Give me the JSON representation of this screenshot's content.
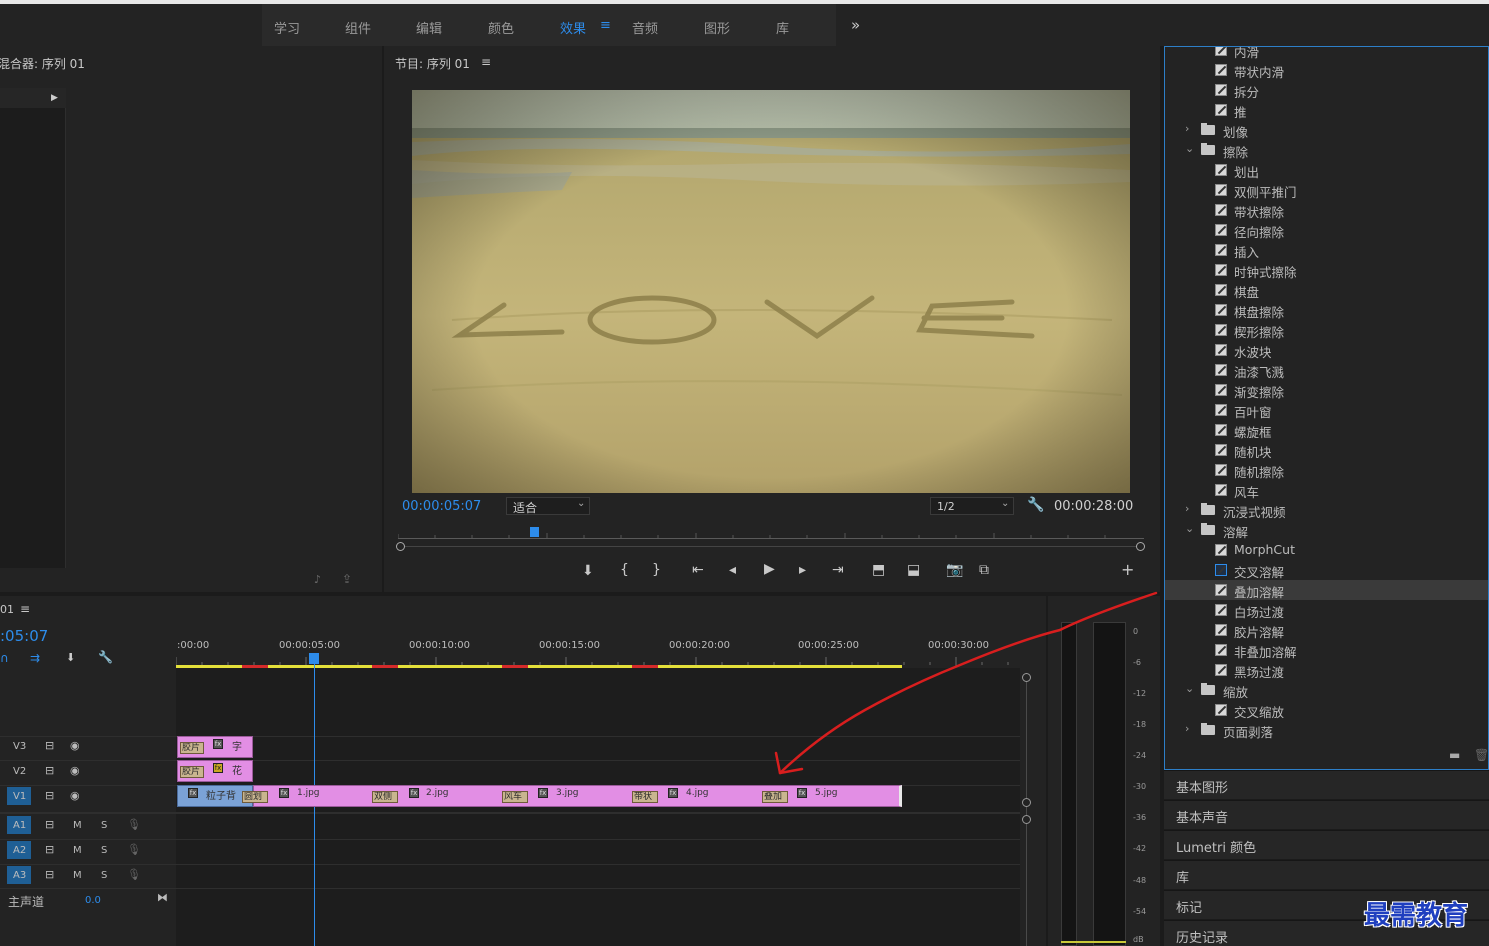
{
  "workspace_tabs": [
    "学习",
    "组件",
    "编辑",
    "颜色",
    "效果",
    "音频",
    "图形",
    "库"
  ],
  "workspace_active": "效果",
  "workspace_menu_icon": "≡",
  "workspace_more": "»",
  "source_panel": {
    "title": "混合器: 序列 01",
    "play_glyph": "▶"
  },
  "program_monitor": {
    "title": "节目: 序列 01",
    "menu_glyph": "≡",
    "current_time": "00:00:05:07",
    "fit_label": "适合",
    "resolution": "1/2",
    "duration": "00:00:28:00",
    "image_text": "LOVE"
  },
  "effects_list": [
    {
      "kind": "item",
      "label": "内滑"
    },
    {
      "kind": "item",
      "label": "带状内滑"
    },
    {
      "kind": "item",
      "label": "拆分"
    },
    {
      "kind": "item",
      "label": "推"
    },
    {
      "kind": "folder",
      "label": "划像",
      "open": false
    },
    {
      "kind": "folder",
      "label": "擦除",
      "open": true
    },
    {
      "kind": "item",
      "label": "划出"
    },
    {
      "kind": "item",
      "label": "双侧平推门"
    },
    {
      "kind": "item",
      "label": "带状擦除"
    },
    {
      "kind": "item",
      "label": "径向擦除"
    },
    {
      "kind": "item",
      "label": "插入"
    },
    {
      "kind": "item",
      "label": "时钟式擦除"
    },
    {
      "kind": "item",
      "label": "棋盘"
    },
    {
      "kind": "item",
      "label": "棋盘擦除"
    },
    {
      "kind": "item",
      "label": "楔形擦除"
    },
    {
      "kind": "item",
      "label": "水波块"
    },
    {
      "kind": "item",
      "label": "油漆飞溅"
    },
    {
      "kind": "item",
      "label": "渐变擦除"
    },
    {
      "kind": "item",
      "label": "百叶窗"
    },
    {
      "kind": "item",
      "label": "螺旋框"
    },
    {
      "kind": "item",
      "label": "随机块"
    },
    {
      "kind": "item",
      "label": "随机擦除"
    },
    {
      "kind": "item",
      "label": "风车"
    },
    {
      "kind": "folder",
      "label": "沉浸式视频",
      "open": false
    },
    {
      "kind": "folder",
      "label": "溶解",
      "open": true
    },
    {
      "kind": "item",
      "label": "MorphCut"
    },
    {
      "kind": "item",
      "label": "交叉溶解",
      "highlight": true
    },
    {
      "kind": "item",
      "label": "叠加溶解",
      "selected": true
    },
    {
      "kind": "item",
      "label": "白场过渡"
    },
    {
      "kind": "item",
      "label": "胶片溶解"
    },
    {
      "kind": "item",
      "label": "非叠加溶解"
    },
    {
      "kind": "item",
      "label": "黑场过渡"
    },
    {
      "kind": "folder",
      "label": "缩放",
      "open": true
    },
    {
      "kind": "item",
      "label": "交叉缩放"
    },
    {
      "kind": "folder",
      "label": "页面剥落",
      "open": false
    }
  ],
  "side_panels": [
    "基本图形",
    "基本声音",
    "Lumetri 颜色",
    "库",
    "标记",
    "历史记录"
  ],
  "timeline": {
    "title": "01",
    "menu_glyph": "≡",
    "timecode": ":05:07",
    "ruler": [
      ":00:00",
      "00:00:05:00",
      "00:00:10:00",
      "00:00:15:00",
      "00:00:20:00",
      "00:00:25:00",
      "00:00:30:00"
    ],
    "video_tracks": [
      "V3",
      "V2",
      "V1"
    ],
    "audio_tracks": [
      "A1",
      "A2",
      "A3"
    ],
    "audio_m": "M",
    "audio_s": "S",
    "master_label": "主声道",
    "master_value": "0.0",
    "v3_clip": {
      "trans": "胶片",
      "name": "字"
    },
    "v2_clip": {
      "trans": "胶片",
      "name": "花"
    },
    "v1_clips": [
      {
        "trans": "",
        "name": "粒子背"
      },
      {
        "trans": "圆划",
        "name": "1.jpg"
      },
      {
        "trans": "双侧",
        "name": "2.jpg"
      },
      {
        "trans": "风车",
        "name": "3.jpg"
      },
      {
        "trans": "带状",
        "name": "4.jpg"
      },
      {
        "trans": "叠加",
        "name": "5.jpg"
      }
    ],
    "fx_label": "fx"
  },
  "audio_meter": {
    "scale": [
      "0",
      "-6",
      "-12",
      "-18",
      "-24",
      "-30",
      "-36",
      "-42",
      "-48",
      "-54",
      "dB"
    ]
  },
  "watermark": "最需教育",
  "colors": {
    "accent": "#2d8ceb",
    "clip": "#e28ee4",
    "annotation": "#d81e1e"
  }
}
